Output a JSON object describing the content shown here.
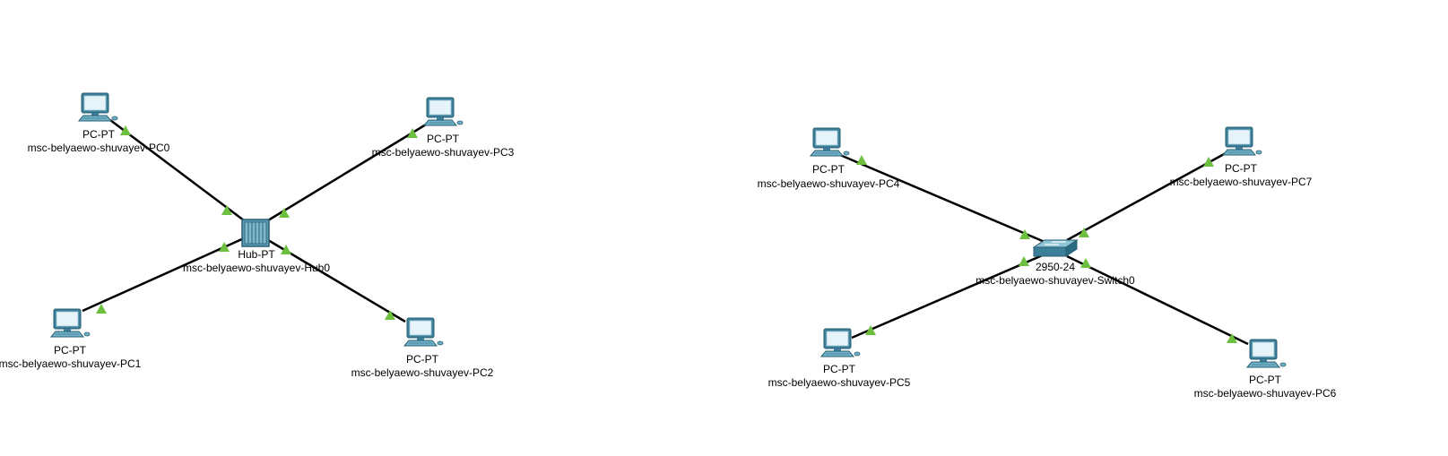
{
  "colors": {
    "link": "#000000",
    "port_up": "#6cbf3f",
    "device_blue": "#4a90a8"
  },
  "devices": [
    {
      "id": "PC0",
      "model": "PC-PT",
      "name": "msc-belyaewo-shuvayev-PC0",
      "icon": "pc-icon"
    },
    {
      "id": "PC1",
      "model": "PC-PT",
      "name": "msc-belyaewo-shuvayev-PC1",
      "icon": "pc-icon"
    },
    {
      "id": "PC2",
      "model": "PC-PT",
      "name": "msc-belyaewo-shuvayev-PC2",
      "icon": "pc-icon"
    },
    {
      "id": "PC3",
      "model": "PC-PT",
      "name": "msc-belyaewo-shuvayev-PC3",
      "icon": "pc-icon"
    },
    {
      "id": "Hub0",
      "model": "Hub-PT",
      "name": "msc-belyaewo-shuvayev-Hub0",
      "icon": "hub-icon"
    },
    {
      "id": "PC4",
      "model": "PC-PT",
      "name": "msc-belyaewo-shuvayev-PC4",
      "icon": "pc-icon"
    },
    {
      "id": "PC5",
      "model": "PC-PT",
      "name": "msc-belyaewo-shuvayev-PC5",
      "icon": "pc-icon"
    },
    {
      "id": "PC6",
      "model": "PC-PT",
      "name": "msc-belyaewo-shuvayev-PC6",
      "icon": "pc-icon"
    },
    {
      "id": "PC7",
      "model": "PC-PT",
      "name": "msc-belyaewo-shuvayev-PC7",
      "icon": "pc-icon"
    },
    {
      "id": "Switch0",
      "model": "2950-24",
      "name": "msc-belyaewo-shuvayev-Switch0",
      "icon": "switch-icon"
    }
  ],
  "links": [
    {
      "from": "PC0",
      "to": "Hub0",
      "status": "up"
    },
    {
      "from": "PC3",
      "to": "Hub0",
      "status": "up"
    },
    {
      "from": "PC1",
      "to": "Hub0",
      "status": "up"
    },
    {
      "from": "PC2",
      "to": "Hub0",
      "status": "up"
    },
    {
      "from": "PC4",
      "to": "Switch0",
      "status": "up"
    },
    {
      "from": "PC7",
      "to": "Switch0",
      "status": "up"
    },
    {
      "from": "PC5",
      "to": "Switch0",
      "status": "up"
    },
    {
      "from": "PC6",
      "to": "Switch0",
      "status": "up"
    }
  ]
}
